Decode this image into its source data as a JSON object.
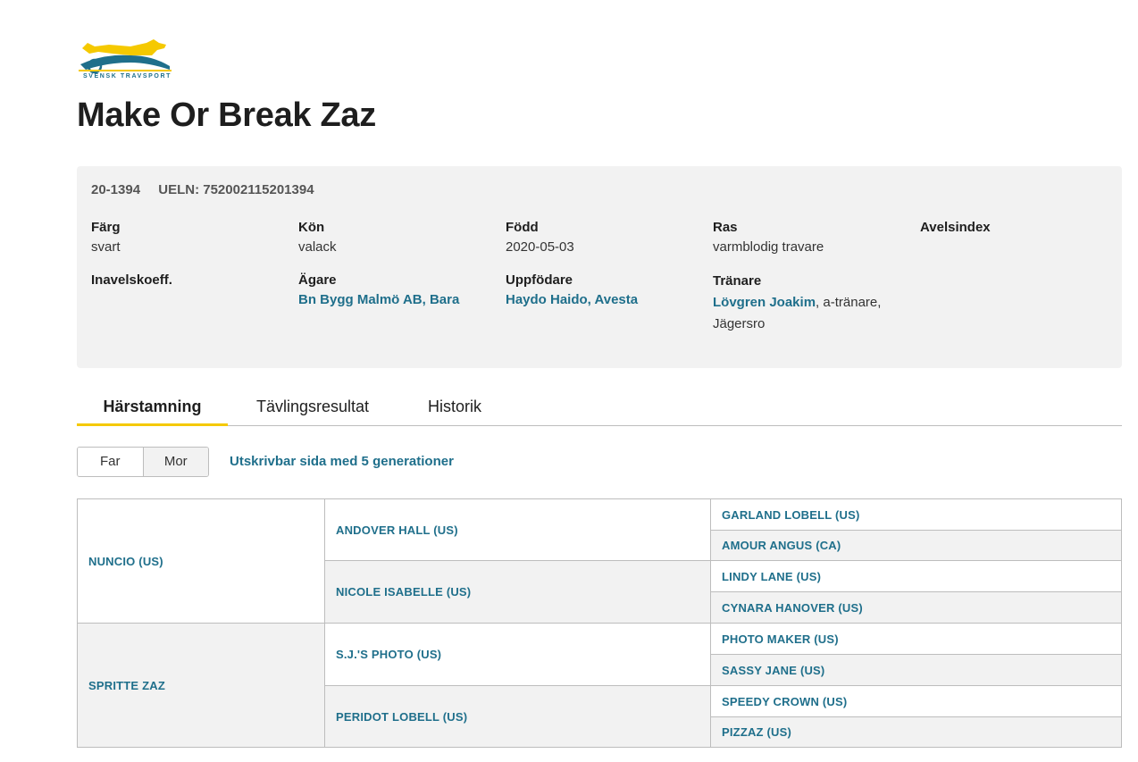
{
  "logo": {
    "text": "SVENSK TRAVSPORT",
    "colors": {
      "yellow": "#f5c900",
      "blue": "#1f6f8b"
    }
  },
  "horse": {
    "name": "Make Or Break Zaz",
    "reg_no": "20-1394",
    "ueln": "UELN: 752002115201394"
  },
  "info": {
    "farg": {
      "label": "Färg",
      "value": "svart"
    },
    "kon": {
      "label": "Kön",
      "value": "valack"
    },
    "fodd": {
      "label": "Född",
      "value": "2020-05-03"
    },
    "ras": {
      "label": "Ras",
      "value": "varmblodig travare"
    },
    "avelsindex": {
      "label": "Avelsindex"
    },
    "inavel": {
      "label": "Inavelskoeff."
    },
    "agare": {
      "label": "Ägare",
      "value": "Bn Bygg Malmö AB, Bara"
    },
    "uppfodare": {
      "label": "Uppfödare",
      "value": "Haydo Haido, Avesta"
    },
    "tranare": {
      "label": "Tränare",
      "name": "Lövgren Joakim",
      "suffix": ", a-tränare,",
      "place": "Jägersro"
    }
  },
  "tabs": [
    "Härstamning",
    "Tävlingsresultat",
    "Historik"
  ],
  "segment": {
    "far": "Far",
    "mor": "Mor"
  },
  "print_link": "Utskrivbar sida med 5 generationer",
  "pedigree": {
    "gen1": [
      "NUNCIO (US)",
      "SPRITTE ZAZ"
    ],
    "gen2": [
      "ANDOVER HALL (US)",
      "NICOLE ISABELLE (US)",
      "S.J.'S PHOTO (US)",
      "PERIDOT LOBELL (US)"
    ],
    "gen3": [
      "GARLAND LOBELL (US)",
      "AMOUR ANGUS (CA)",
      "LINDY LANE (US)",
      "CYNARA HANOVER (US)",
      "PHOTO MAKER (US)",
      "SASSY JANE (US)",
      "SPEEDY CROWN (US)",
      "PIZZAZ (US)"
    ]
  }
}
